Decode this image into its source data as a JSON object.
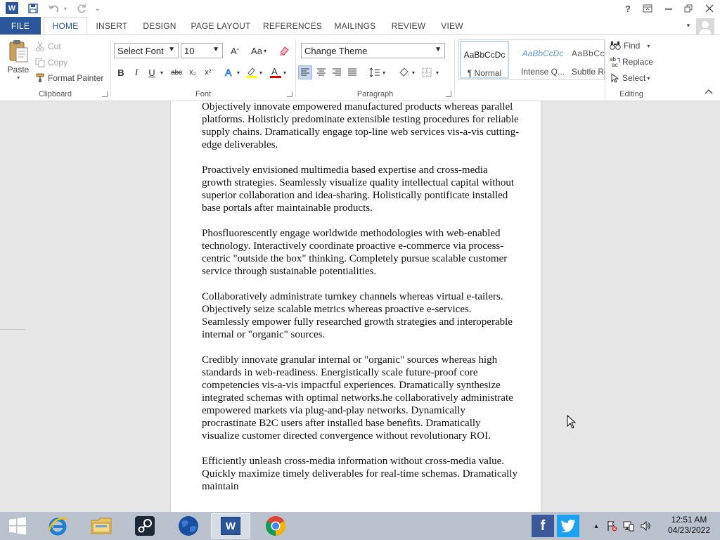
{
  "titlebar": {
    "app_icon": "word-icon",
    "app_letter": "W",
    "help": "?",
    "qat_customize": "⌄"
  },
  "tabs": [
    {
      "label": "FILE",
      "kind": "file"
    },
    {
      "label": "HOME",
      "kind": "active"
    },
    {
      "label": "INSERT",
      "kind": ""
    },
    {
      "label": "DESIGN",
      "kind": ""
    },
    {
      "label": "PAGE LAYOUT",
      "kind": ""
    },
    {
      "label": "REFERENCES",
      "kind": ""
    },
    {
      "label": "MAILINGS",
      "kind": ""
    },
    {
      "label": "REVIEW",
      "kind": ""
    },
    {
      "label": "VIEW",
      "kind": ""
    }
  ],
  "ribbon": {
    "clipboard": {
      "label": "Clipboard",
      "paste": "Paste",
      "cut": "Cut",
      "copy": "Copy",
      "format_painter": "Format Painter"
    },
    "font": {
      "label": "Font",
      "font_name": "Select Font",
      "font_size": "10",
      "bold": "B",
      "italic": "I",
      "underline": "U",
      "strike": "abc",
      "subscript": "x₂",
      "superscript": "x²",
      "grow": "A",
      "change_case": "Aa"
    },
    "paragraph": {
      "label": "Paragraph",
      "theme": "Change Theme"
    },
    "styles": {
      "items": [
        {
          "sample": "AaBbCcDc",
          "name": "¶ Normal"
        },
        {
          "sample": "AaBbCcDc",
          "name": "Intense Q..."
        },
        {
          "sample": "AaBbCcD",
          "name": "Subtle Re..."
        }
      ]
    },
    "editing": {
      "label": "Editing",
      "find": "Find",
      "replace": "Replace",
      "select": "Select"
    }
  },
  "document": {
    "paragraphs": [
      "Objectively innovate empowered manufactured products whereas parallel platforms. Holisticly predominate extensible testing procedures for reliable supply chains. Dramatically engage top-line web services vis-a-vis cutting-edge deliverables.",
      "Proactively envisioned multimedia based expertise and cross-media growth strategies. Seamlessly visualize quality intellectual capital without superior collaboration and idea-sharing. Holistically pontificate installed base portals after maintainable products.",
      "Phosfluorescently engage worldwide methodologies with web-enabled technology. Interactively coordinate proactive e-commerce via process-centric \"outside the box\" thinking. Completely pursue scalable customer service through sustainable potentialities.",
      "Collaboratively administrate turnkey channels whereas virtual e-tailers. Objectively seize scalable metrics whereas proactive e-services. Seamlessly empower fully researched growth strategies and interoperable internal or \"organic\" sources.",
      "Credibly innovate granular internal or \"organic\" sources whereas high standards in web-readiness. Energistically scale future-proof core competencies vis-a-vis impactful experiences. Dramatically synthesize integrated schemas with optimal networks.he collaboratively administrate empowered markets via plug-and-play networks. Dynamically procrastinate B2C users after installed base benefits. Dramatically visualize customer directed convergence without revolutionary ROI.",
      "Efficiently unleash cross-media information without cross-media value. Quickly maximize timely deliverables for real-time schemas. Dramatically maintain"
    ]
  },
  "taskbar": {
    "clock_time": "12:51 AM",
    "clock_date": "04/23/2022",
    "facebook": "f",
    "word_letter": "W",
    "colors": {
      "taskbar": "#b9c2cd",
      "word_blue": "#2b579a",
      "facebook": "#3b5998",
      "twitter": "#1da1f2"
    }
  }
}
